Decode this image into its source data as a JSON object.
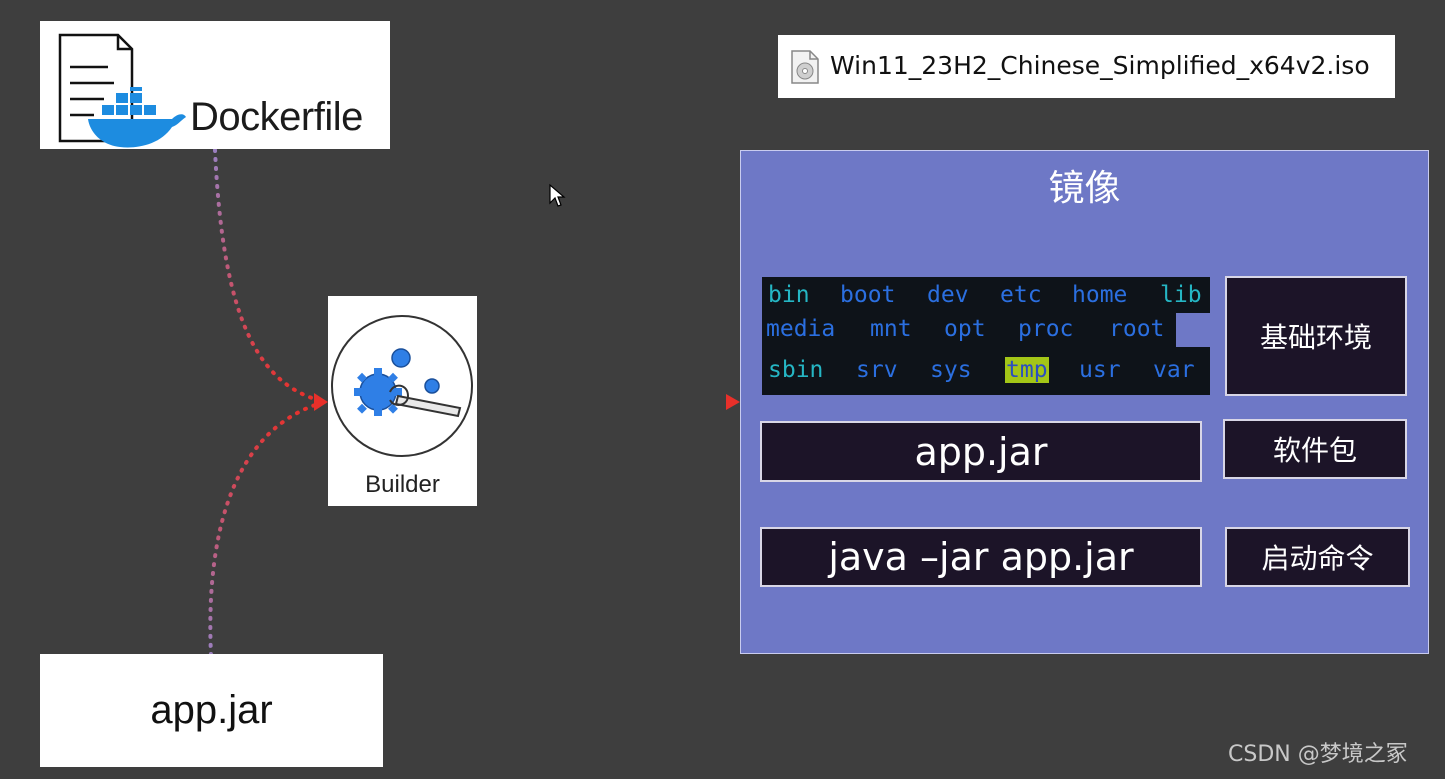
{
  "dockerfile": {
    "label": "Dockerfile"
  },
  "source_jar": {
    "label": "app.jar"
  },
  "builder": {
    "label": "Builder"
  },
  "iso_file": {
    "name": "Win11_23H2_Chinese_Simplified_x64v2.iso",
    "icon": "disc-file-icon"
  },
  "image_panel": {
    "title": "镜像",
    "directories": {
      "row1": [
        "bin",
        "boot",
        "dev",
        "etc",
        "home",
        "lib"
      ],
      "row2": [
        "media",
        "mnt",
        "opt",
        "proc",
        "root"
      ],
      "row3": [
        "sbin",
        "srv",
        "sys",
        "tmp",
        "usr",
        "var"
      ]
    },
    "layers": {
      "base_env": "基础环境",
      "app_jar": "app.jar",
      "package": "软件包",
      "command": "java –jar app.jar",
      "command_label": "启动命令"
    }
  },
  "watermark": "CSDN @梦境之冢",
  "colors": {
    "background": "#3e3e3e",
    "panel": "#6e78c6",
    "dark_box": "#1c1428",
    "arrow_red": "#e8302a",
    "arrow_purple": "#9a7fc0"
  }
}
